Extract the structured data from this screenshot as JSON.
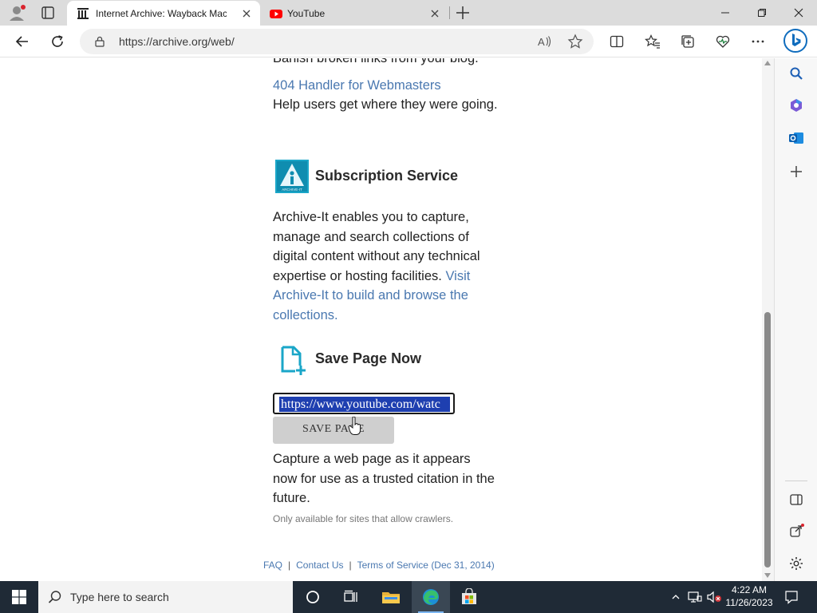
{
  "browser": {
    "tabs": [
      {
        "title": "Internet Archive: Wayback Machine",
        "favicon": "archive-icon",
        "active": true
      },
      {
        "title": "YouTube",
        "favicon": "youtube-icon",
        "active": false
      }
    ],
    "url": "https://archive.org/web/",
    "accent": "#0f6cbd"
  },
  "page": {
    "intro_tail": "Banish broken links from your blog.",
    "handler": {
      "link": "404 Handler for Webmasters",
      "desc": "Help users get where they were going."
    },
    "subscription": {
      "title": "Subscription Service",
      "logo_text": "ARCHIVE-IT",
      "desc": "Archive-It enables you to capture, manage and search collections of digital content without any technical expertise or hosting facilities.",
      "link": "Visit Archive-It to build and browse the collections."
    },
    "save_page": {
      "title": "Save Page Now",
      "input_value": "https://www.youtube.com/watc",
      "button_label": "SAVE PAGE",
      "desc": "Capture a web page as it appears now for use as a trusted citation in the future.",
      "note": "Only available for sites that allow crawlers."
    },
    "footer": {
      "faq": "FAQ",
      "contact": "Contact Us",
      "terms": "Terms of Service (Dec 31, 2014)",
      "separator": "|"
    },
    "link_color": "#4a78b0"
  },
  "taskbar": {
    "search_placeholder": "Type here to search",
    "time": "4:22 AM",
    "date": "11/26/2023"
  }
}
